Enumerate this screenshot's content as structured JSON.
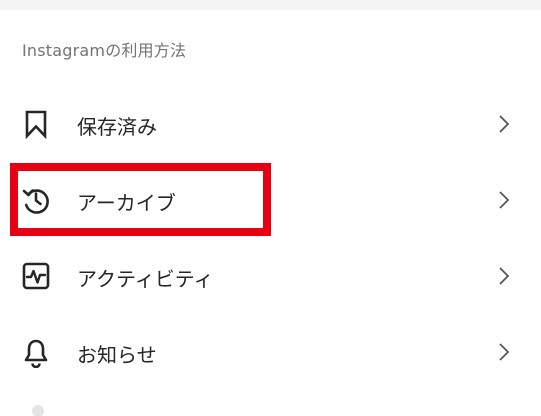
{
  "section": {
    "title": "Instagramの利用方法"
  },
  "menu": {
    "items": [
      {
        "label": "保存済み",
        "icon": "bookmark-icon"
      },
      {
        "label": "アーカイブ",
        "icon": "archive-history-icon"
      },
      {
        "label": "アクティビティ",
        "icon": "activity-icon"
      },
      {
        "label": "お知らせ",
        "icon": "bell-icon"
      }
    ]
  },
  "colors": {
    "text": "#262626",
    "muted": "#737373",
    "highlight": "#e60012"
  }
}
